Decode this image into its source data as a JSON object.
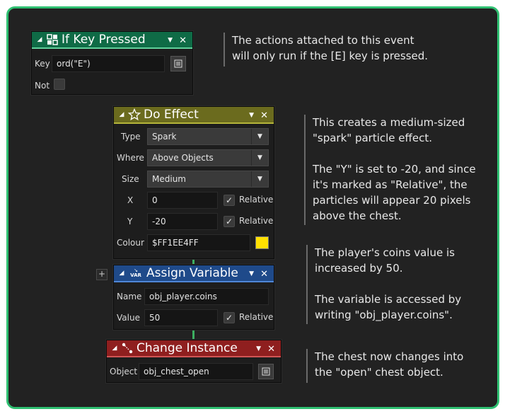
{
  "colors": {
    "frame_border": "#2fbf71",
    "background": "#222222",
    "key_pressed_header": "#0f6b46",
    "do_effect_header": "#6b6b1e",
    "assign_variable_header": "#1f4a8a",
    "change_instance_header": "#8f1f1f",
    "colour_swatch": "#FFE000",
    "connector": "#3cae60"
  },
  "blocks": {
    "key_pressed": {
      "title": "If Key Pressed",
      "icon": "grid-icon",
      "key_label": "Key",
      "key_value": "ord(\"E\")",
      "not_label": "Not",
      "not_checked": false
    },
    "do_effect": {
      "title": "Do Effect",
      "icon": "star-icon",
      "type_label": "Type",
      "type_value": "Spark",
      "where_label": "Where",
      "where_value": "Above Objects",
      "size_label": "Size",
      "size_value": "Medium",
      "x_label": "X",
      "x_value": "0",
      "x_relative_label": "Relative",
      "x_relative_checked": true,
      "y_label": "Y",
      "y_value": "-20",
      "y_relative_label": "Relative",
      "y_relative_checked": true,
      "colour_label": "Colour",
      "colour_value": "$FF1EE4FF"
    },
    "assign_variable": {
      "title": "Assign Variable",
      "icon": "var-icon",
      "icon_text": "VAR",
      "name_label": "Name",
      "name_value": "obj_player.coins",
      "value_label": "Value",
      "value_value": "50",
      "relative_label": "Relative",
      "relative_checked": true
    },
    "change_instance": {
      "title": "Change Instance",
      "icon": "change-instance-icon",
      "object_label": "Object",
      "object_value": "obj_chest_open"
    }
  },
  "glyphs": {
    "collapse": "◢",
    "dropdown": "▼",
    "close": "✕",
    "check": "✓",
    "add": "+"
  },
  "notes": {
    "key_pressed": [
      "The actions attached to this event",
      "will only run if the [E] key is pressed."
    ],
    "do_effect_1": [
      "This creates a medium-sized",
      "\"spark\" particle effect."
    ],
    "do_effect_2": [
      "The \"Y\" is set to -20, and since",
      "it's marked as \"Relative\", the",
      "particles will appear 20 pixels",
      "above the chest."
    ],
    "assign_1": [
      "The player's coins value is",
      "increased by 50."
    ],
    "assign_2": [
      "The variable is accessed by",
      "writing \"obj_player.coins\"."
    ],
    "change_instance": [
      "The chest now changes into",
      "the \"open\" chest object."
    ]
  }
}
